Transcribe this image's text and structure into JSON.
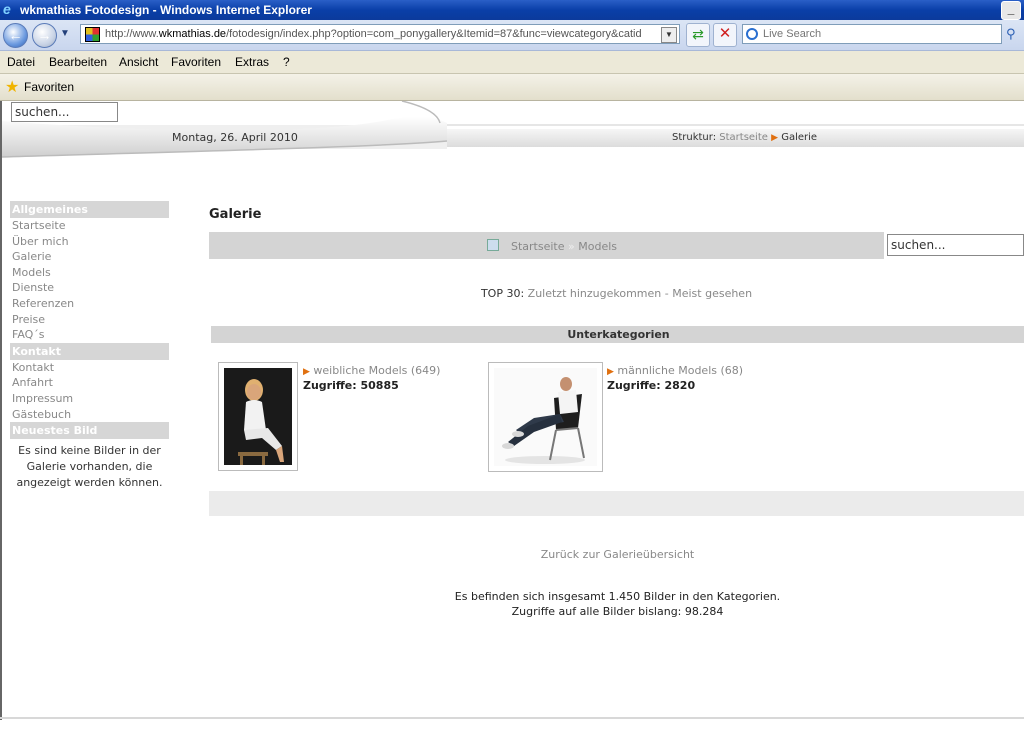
{
  "window": {
    "title": "wkmathias Fotodesign - Windows Internet Explorer",
    "min_glyph": "_"
  },
  "browser": {
    "url_prefix": "http://www.",
    "url_host": "wkmathias.de",
    "url_rest": "/fotodesign/index.php?option=com_ponygallery&Itemid=87&func=viewcategory&catid",
    "search_placeholder": "Live Search",
    "menu": [
      "Datei",
      "Bearbeiten",
      "Ansicht",
      "Favoriten",
      "Extras",
      "?"
    ],
    "favorites_label": "Favoriten"
  },
  "page": {
    "header": {
      "search_value": "suchen...",
      "date": "Montag, 26. April 2010",
      "breadcrumb_label": "Struktur:",
      "breadcrumb_home": "Startseite",
      "breadcrumb_current": "Galerie"
    },
    "sidebar": {
      "sections": [
        {
          "title": "Allgemeines",
          "items": [
            "Startseite",
            "Über mich",
            "Galerie",
            "Models",
            "Dienste",
            "Referenzen",
            "Preise",
            "FAQ´s"
          ]
        },
        {
          "title": "Kontakt",
          "items": [
            "Kontakt",
            "Anfahrt",
            "Impressum",
            "Gästebuch"
          ]
        },
        {
          "title": "Neuestes Bild",
          "text": "Es sind keine Bilder in der Galerie vorhanden, die angezeigt werden können."
        }
      ]
    },
    "main": {
      "title": "Galerie",
      "crumbs": {
        "home": "Startseite",
        "separator": "»",
        "current": "Models"
      },
      "search_value": "suchen...",
      "top30": {
        "label": "TOP 30:",
        "latest": "Zuletzt hinzugekommen",
        "sep": " - ",
        "most_viewed": "Meist gesehen"
      },
      "subcategories_label": "Unterkategorien",
      "categories": [
        {
          "name": "weibliche Models (649)",
          "hits": "Zugriffe: 50885"
        },
        {
          "name": "männliche Models (68)",
          "hits": "Zugriffe: 2820"
        }
      ],
      "back_link": "Zurück zur Galerieübersicht",
      "stats_line1": "Es befinden sich insgesamt 1.450 Bilder in den Kategorien.",
      "stats_line2": "Zugriffe auf alle Bilder bislang: 98.284"
    }
  }
}
